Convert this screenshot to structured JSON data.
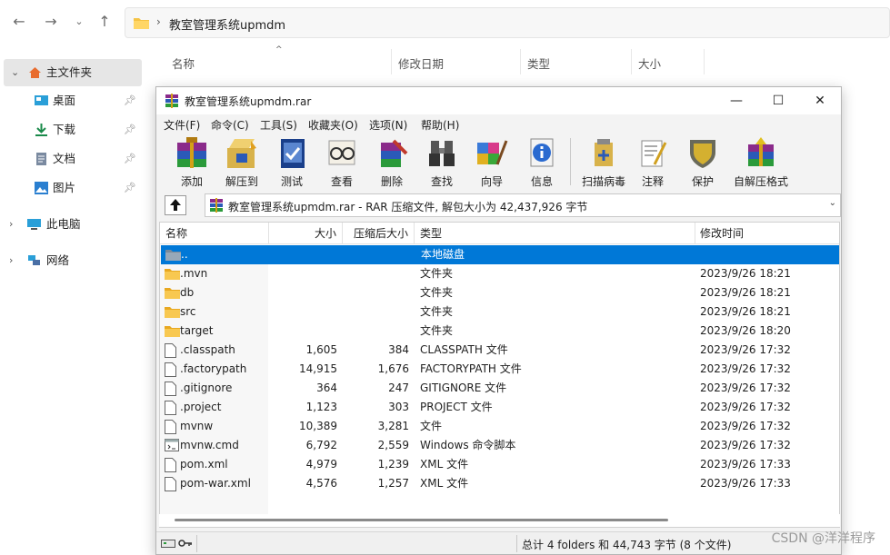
{
  "explorer": {
    "path": "教室管理系统upmdm",
    "sidebar": [
      {
        "label": "主文件夹",
        "icon": "home-icon",
        "selected": true
      },
      {
        "label": "桌面",
        "icon": "desktop-icon",
        "pinned": true
      },
      {
        "label": "下载",
        "icon": "download-icon",
        "pinned": true
      },
      {
        "label": "文档",
        "icon": "document-icon",
        "pinned": true
      },
      {
        "label": "图片",
        "icon": "picture-icon",
        "pinned": true
      },
      {
        "label": "此电脑",
        "icon": "computer-icon"
      },
      {
        "label": "网络",
        "icon": "network-icon"
      }
    ],
    "columns": [
      "名称",
      "修改日期",
      "类型",
      "大小"
    ]
  },
  "winrar": {
    "title": "教室管理系统upmdm.rar",
    "menus": [
      "文件(F)",
      "命令(C)",
      "工具(S)",
      "收藏夹(O)",
      "选项(N)",
      "帮助(H)"
    ],
    "tools": [
      "添加",
      "解压到",
      "测试",
      "查看",
      "删除",
      "查找",
      "向导",
      "信息",
      "扫描病毒",
      "注释",
      "保护",
      "自解压格式"
    ],
    "archive_path": "教室管理系统upmdm.rar - RAR 压缩文件, 解包大小为 42,437,926 字节",
    "columns": [
      "名称",
      "大小",
      "压缩后大小",
      "类型",
      "修改时间"
    ],
    "files": [
      {
        "name": "..",
        "size": "",
        "packed": "",
        "type": "本地磁盘",
        "modified": "",
        "kind": "folder",
        "selected": true
      },
      {
        "name": ".mvn",
        "size": "",
        "packed": "",
        "type": "文件夹",
        "modified": "2023/9/26 18:21",
        "kind": "folder"
      },
      {
        "name": "db",
        "size": "",
        "packed": "",
        "type": "文件夹",
        "modified": "2023/9/26 18:21",
        "kind": "folder"
      },
      {
        "name": "src",
        "size": "",
        "packed": "",
        "type": "文件夹",
        "modified": "2023/9/26 18:21",
        "kind": "folder"
      },
      {
        "name": "target",
        "size": "",
        "packed": "",
        "type": "文件夹",
        "modified": "2023/9/26 18:20",
        "kind": "folder"
      },
      {
        "name": ".classpath",
        "size": "1,605",
        "packed": "384",
        "type": "CLASSPATH 文件",
        "modified": "2023/9/26 17:32",
        "kind": "file"
      },
      {
        "name": ".factorypath",
        "size": "14,915",
        "packed": "1,676",
        "type": "FACTORYPATH 文件",
        "modified": "2023/9/26 17:32",
        "kind": "file"
      },
      {
        "name": ".gitignore",
        "size": "364",
        "packed": "247",
        "type": "GITIGNORE 文件",
        "modified": "2023/9/26 17:32",
        "kind": "file"
      },
      {
        "name": ".project",
        "size": "1,123",
        "packed": "303",
        "type": "PROJECT 文件",
        "modified": "2023/9/26 17:32",
        "kind": "file"
      },
      {
        "name": "mvnw",
        "size": "10,389",
        "packed": "3,281",
        "type": "文件",
        "modified": "2023/9/26 17:32",
        "kind": "file"
      },
      {
        "name": "mvnw.cmd",
        "size": "6,792",
        "packed": "2,559",
        "type": "Windows 命令脚本",
        "modified": "2023/9/26 17:32",
        "kind": "cmd"
      },
      {
        "name": "pom.xml",
        "size": "4,979",
        "packed": "1,239",
        "type": "XML 文件",
        "modified": "2023/9/26 17:33",
        "kind": "file"
      },
      {
        "name": "pom-war.xml",
        "size": "4,576",
        "packed": "1,257",
        "type": "XML 文件",
        "modified": "2023/9/26 17:33",
        "kind": "file"
      }
    ],
    "status": "总计 4 folders 和 44,743 字节 (8 个文件)"
  },
  "watermark": "CSDN @洋洋程序",
  "colors": {
    "selection": "#0078d7",
    "folder": "#f5c344",
    "accent": "#0067c0"
  }
}
